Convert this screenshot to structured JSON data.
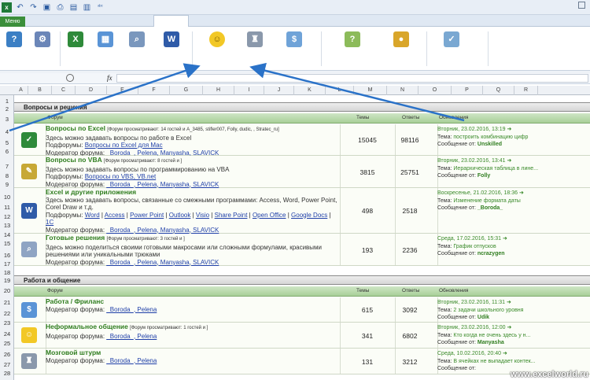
{
  "menu_tab": "Меню",
  "ribbon_icons": [
    "excel-icon",
    "tool-icon",
    "excel-icon",
    "search-icon",
    "word-icon",
    "smiley-icon",
    "chess-icon",
    "dollar-icon",
    "table-icon",
    "coins-icon",
    "grid-icon"
  ],
  "formula_bar": {
    "fx": "fx"
  },
  "columns": [
    "A",
    "B",
    "C",
    "D",
    "E",
    "F",
    "G",
    "H",
    "I",
    "J",
    "K",
    "L",
    "M",
    "N",
    "O",
    "P",
    "Q",
    "R"
  ],
  "rows": [
    "1",
    "2",
    "3",
    "4",
    "5",
    "6",
    "7",
    "8",
    "9",
    "10",
    "11",
    "12",
    "13",
    "14",
    "15",
    "16",
    "17",
    "18",
    "19",
    "20",
    "21",
    "22",
    "23",
    "24",
    "25",
    "26",
    "27",
    "28"
  ],
  "sections": {
    "s1": "Вопросы и решения",
    "s2": "Работа и общение"
  },
  "headers": {
    "forum": "Форум",
    "topics": "Темы",
    "answers": "Ответы",
    "updates": "Обновления"
  },
  "forums1": [
    {
      "title": "Вопросы по Excel",
      "view": "[Форум просматривают: 14 гостей и A_3485, stifler007, Folly, dudic, , Stratec_ru]",
      "desc": "Здесь можно задавать вопросы по работе в Excel",
      "sub_label": "Подфорумы:",
      "sub": "Вопросы по Excel для Мас",
      "mod_label": "Модератор форума:",
      "mods": "_Boroda_, Pelena, Manyasha, SLAVICK",
      "topics": "15045",
      "answers": "98116",
      "date": "Вторник, 23.02.2016, 13:19",
      "theme_label": "Тема:",
      "theme": "построить комбинацию цифр",
      "msg_label": "Сообщение от:",
      "msg": "Unskilled"
    },
    {
      "title": "Вопросы по VBA",
      "view": "[Форум просматривают: 8 гостей и ]",
      "desc": "Здесь можно задавать вопросы по программированию на VBA",
      "sub_label": "Подфорумы:",
      "sub": "Вопросы по VBS, VB.net",
      "mod_label": "Модератор форума:",
      "mods": "_Boroda_, Pelena, Manyasha, SLAVICK",
      "topics": "3815",
      "answers": "25751",
      "date": "Вторник, 23.02.2016, 13:41",
      "theme_label": "Тема:",
      "theme": "Иерархическая таблица в лине...",
      "msg_label": "Сообщение от:",
      "msg": "Folly"
    },
    {
      "title": "Excel и другие приложения",
      "desc": "Здесь можно задавать вопросы, связанные со смежными программами: Access, Word, Power Point, Corel Draw и т.д.",
      "sub_label": "Подфорумы:",
      "subs": [
        "Word",
        "Access",
        "Power Point",
        "Outlook",
        "Visio",
        "Share Point",
        "Open Office",
        "Google Docs",
        "1C"
      ],
      "mod_label": "Модератор форума:",
      "mods": "_Boroda_, Pelena, Manyasha, SLAVICK",
      "topics": "498",
      "answers": "2518",
      "date": "Воскресенье, 21.02.2016, 18:36",
      "theme_label": "Тема:",
      "theme": "Изменение формата даты",
      "msg_label": "Сообщение от:",
      "msg": "_Boroda_"
    },
    {
      "title": "Готовые решения",
      "view": "[Форум просматривают: 3 гостей и ]",
      "desc": "Здесь можно поделиться своими готовыми макросами или сложными формулами, красивыми решениями или уникальными трюками",
      "mod_label": "Модератор форума:",
      "mods": "_Boroda_, Pelena, Manyasha, SLAVICK",
      "topics": "193",
      "answers": "2236",
      "date": "Среда, 17.02.2016, 15:31",
      "theme_label": "Тема:",
      "theme": "График отпусков",
      "msg_label": "Сообщение от:",
      "msg": "ncrazygen"
    }
  ],
  "forums2": [
    {
      "title": "Работа / Фриланс",
      "mod_label": "Модератор форума:",
      "mods": "_Boroda_, Pelena",
      "topics": "615",
      "answers": "3092",
      "date": "Вторник, 23.02.2016, 11:31",
      "theme_label": "Тема:",
      "theme": "2 задачи школьного уровня",
      "msg_label": "Сообщение от:",
      "msg": "Udik"
    },
    {
      "title": "Неформальное общение",
      "view": "[Форум просматривают: 1 гостей и ]",
      "mod_label": "Модератор форума:",
      "mods": "_Boroda_, Pelena",
      "topics": "341",
      "answers": "6802",
      "date": "Вторник, 23.02.2016, 12:00",
      "theme_label": "Тема:",
      "theme": "Кто когда не очень здесь у н...",
      "msg_label": "Сообщение от:",
      "msg": "Manyasha"
    },
    {
      "title": "Мозговой штурм",
      "mod_label": "Модератор форума:",
      "mods": "_Boroda_, Pelena",
      "topics": "131",
      "answers": "3212",
      "date": "Среда, 10.02.2016, 20:40",
      "theme_label": "Тема:",
      "theme": "В ячейках не выпадает контек...",
      "msg_label": "Сообщение от:",
      "msg": ""
    }
  ],
  "watermark": "www.excelworld.ru"
}
